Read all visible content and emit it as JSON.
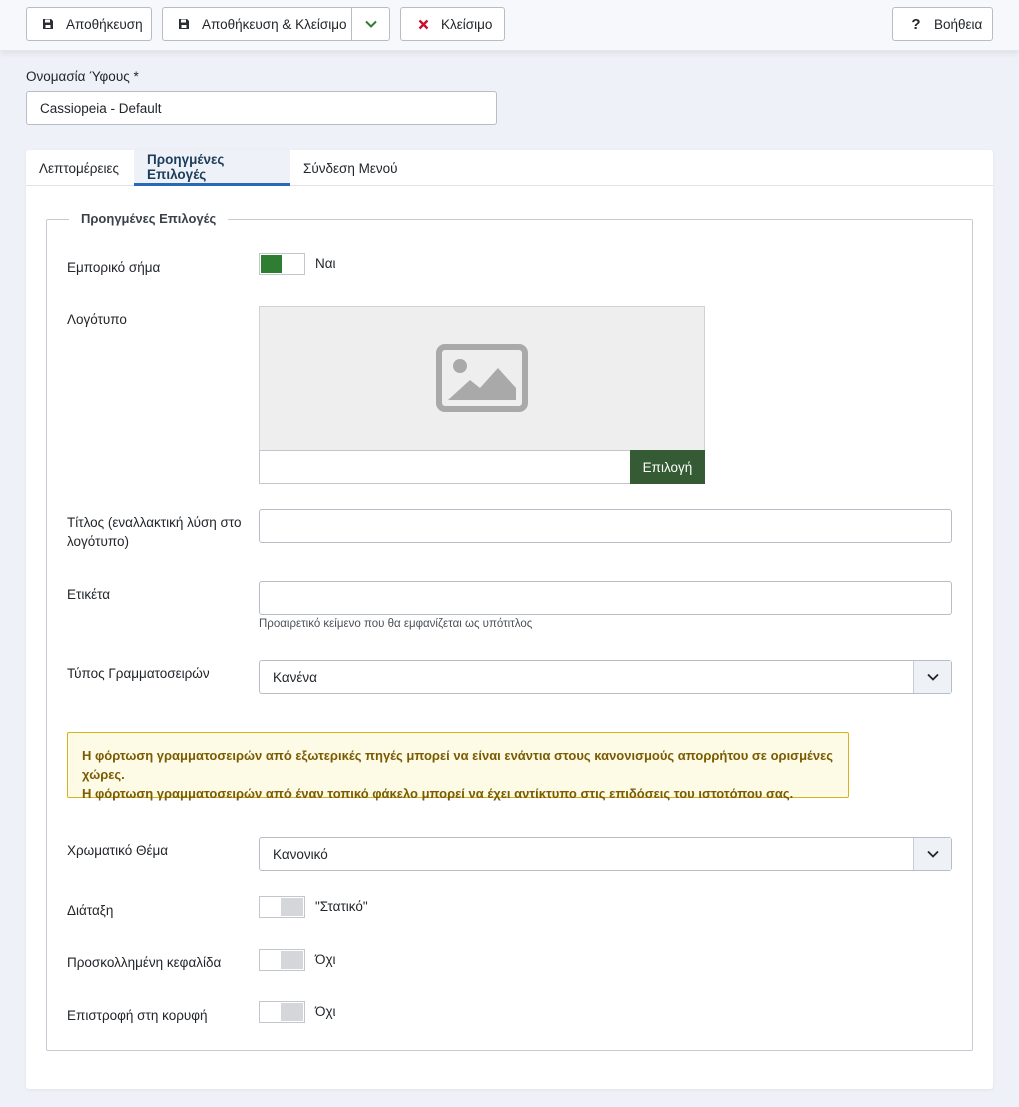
{
  "toolbar": {
    "save_label": "Αποθήκευση",
    "save_close_label": "Αποθήκευση & Κλείσιμο",
    "close_label": "Κλείσιμο",
    "help_label": "Βοήθεια"
  },
  "title_field": {
    "label": "Ονομασία Ύφους *",
    "value": "Cassiopeia - Default"
  },
  "tabs": [
    {
      "label": "Λεπτομέρειες",
      "active": false
    },
    {
      "label": "Προηγμένες Επιλογές",
      "active": true
    },
    {
      "label": "Σύνδεση Μενού",
      "active": false
    }
  ],
  "fieldset": {
    "legend": "Προηγμένες Επιλογές",
    "brand": {
      "label": "Εμπορικό σήμα",
      "value": "Ναι",
      "on": true
    },
    "logo": {
      "label": "Λογότυπο",
      "select_label": "Επιλογή",
      "value": ""
    },
    "site_title": {
      "label": "Τίτλος (εναλλακτική λύση στο λογότυπο)",
      "value": ""
    },
    "tagline": {
      "label": "Ετικέτα",
      "value": "",
      "hint": "Προαιρετικό κείμενο που θα εμφανίζεται ως υπότιτλος"
    },
    "font_type": {
      "label": "Τύπος Γραμματοσειρών",
      "value": "Κανένα"
    },
    "alert": {
      "line1": "Η φόρτωση γραμματοσειρών από εξωτερικές πηγές μπορεί να είναι ενάντια στους κανονισμούς απορρήτου σε ορισμένες χώρες.",
      "line2": "Η φόρτωση γραμματοσειρών από έναν τοπικό φάκελο μπορεί να έχει αντίκτυπο στις επιδόσεις του ιστοτόπου σας."
    },
    "color_theme": {
      "label": "Χρωματικό Θέμα",
      "value": "Κανονικό"
    },
    "layout": {
      "label": "Διάταξη",
      "value": "\"Στατικό\"",
      "on": false
    },
    "sticky_header": {
      "label": "Προσκολλημένη κεφαλίδα",
      "value": "Όχι",
      "on": false
    },
    "back_to_top": {
      "label": "Επιστροφή στη κορυφή",
      "value": "Όχι",
      "on": false
    }
  },
  "colors": {
    "accent": "#2a69b8",
    "switch_on": "#2f7d32",
    "select_button": "#345b33",
    "alert_border": "#d9b11c",
    "close_icon": "#c8102e"
  }
}
